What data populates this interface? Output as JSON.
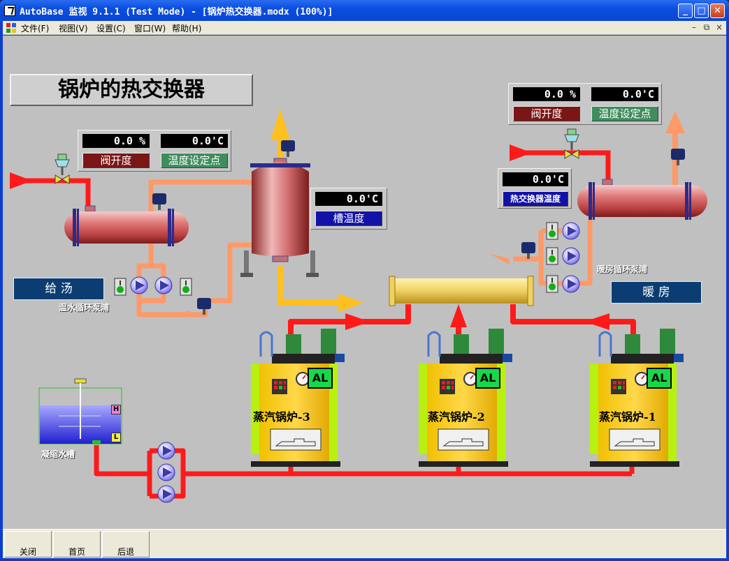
{
  "window": {
    "title": "AutoBase 监视 9.1.1 (Test Mode) - [锅炉热交换器.modx (100%)]",
    "min_glyph": "_",
    "max_glyph": "□",
    "close_glyph": "✕"
  },
  "menu": {
    "items": [
      {
        "label": "文件(F)"
      },
      {
        "label": "视图(V)"
      },
      {
        "label": "设置(C)"
      },
      {
        "label": "窗口(W)"
      },
      {
        "label": "帮助(H)"
      }
    ],
    "mdi_min": "–",
    "mdi_restore": "⧉",
    "mdi_close": "×"
  },
  "screen": {
    "title": "锅炉的热交换器",
    "left_panel": {
      "valve_value": "0.0 %",
      "valve_label": "阀开度",
      "temp_value": "0.0'C",
      "temp_label": "温度设定点"
    },
    "tank_panel": {
      "value": "0.0'C",
      "label": "槽温度"
    },
    "right_panel": {
      "valve_value": "0.0 %",
      "valve_label": "阀开度",
      "temp_value": "0.0'C",
      "temp_label": "温度设定点"
    },
    "hx_panel": {
      "value": "0.0'C",
      "label": "热交换器温度"
    },
    "supply_label": "给    汤",
    "heating_label": "暖    房",
    "hot_water_pump_label": "温水循环泵浦",
    "heating_pump_label": "暖房循环泵浦",
    "condensate_tank_label": "凝缩水槽",
    "tank_high": "H",
    "tank_low": "L",
    "boilers": [
      {
        "name": "蒸汽锅炉-3",
        "alarm": "AL"
      },
      {
        "name": "蒸汽锅炉-2",
        "alarm": "AL"
      },
      {
        "name": "蒸汽锅炉-1",
        "alarm": "AL"
      }
    ]
  },
  "colors": {
    "steam_red": "#ff1a1a",
    "hot_water_orange": "#ff9966",
    "return_yellow": "#ffc020",
    "canvas_gray": "#c0c0c0"
  },
  "bottom_buttons": [
    {
      "label": "关闭"
    },
    {
      "label": "首页"
    },
    {
      "label": "后退"
    }
  ]
}
